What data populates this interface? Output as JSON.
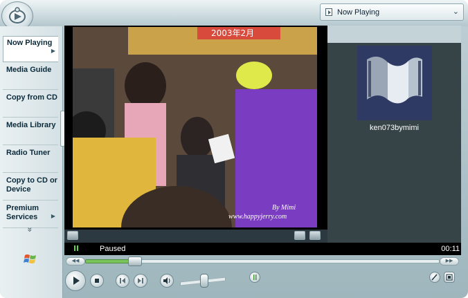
{
  "window": {
    "accent": "#9fb6bd"
  },
  "menu": {
    "selected": "Now Playing",
    "icon": "now-playing-icon"
  },
  "taskbar": {
    "items": [
      {
        "label": "Now Playing",
        "active": true,
        "has_arrow": true
      },
      {
        "label": "Media Guide",
        "active": false,
        "has_arrow": false
      },
      {
        "label": "Copy from CD",
        "active": false,
        "has_arrow": false
      },
      {
        "label": "Media Library",
        "active": false,
        "has_arrow": false
      },
      {
        "label": "Radio Tuner",
        "active": false,
        "has_arrow": false
      },
      {
        "label": "Copy to CD or Device",
        "active": false,
        "has_arrow": false
      },
      {
        "label": "Premium Services",
        "active": false,
        "has_arrow": true
      }
    ],
    "more": "»"
  },
  "video": {
    "watermark_line1": "By Mimi",
    "watermark_line2": "www.happyjerry.com",
    "banner_text": "2003年2月"
  },
  "playlist": {
    "item_title": "ken073bymimi"
  },
  "status": {
    "state": "Paused",
    "time": "00:11",
    "state_color": "#5fd44a"
  },
  "seek": {
    "progress": 0.13
  },
  "volume": {
    "level": 0.45
  },
  "controls": {
    "play": "play-icon",
    "stop": "stop-icon",
    "previous": "previous-icon",
    "next": "next-icon",
    "mute": "speaker-icon",
    "shuffle": "shuffle-icon",
    "equalizer": "equalizer-icon",
    "compact": "compact-mode-icon"
  }
}
